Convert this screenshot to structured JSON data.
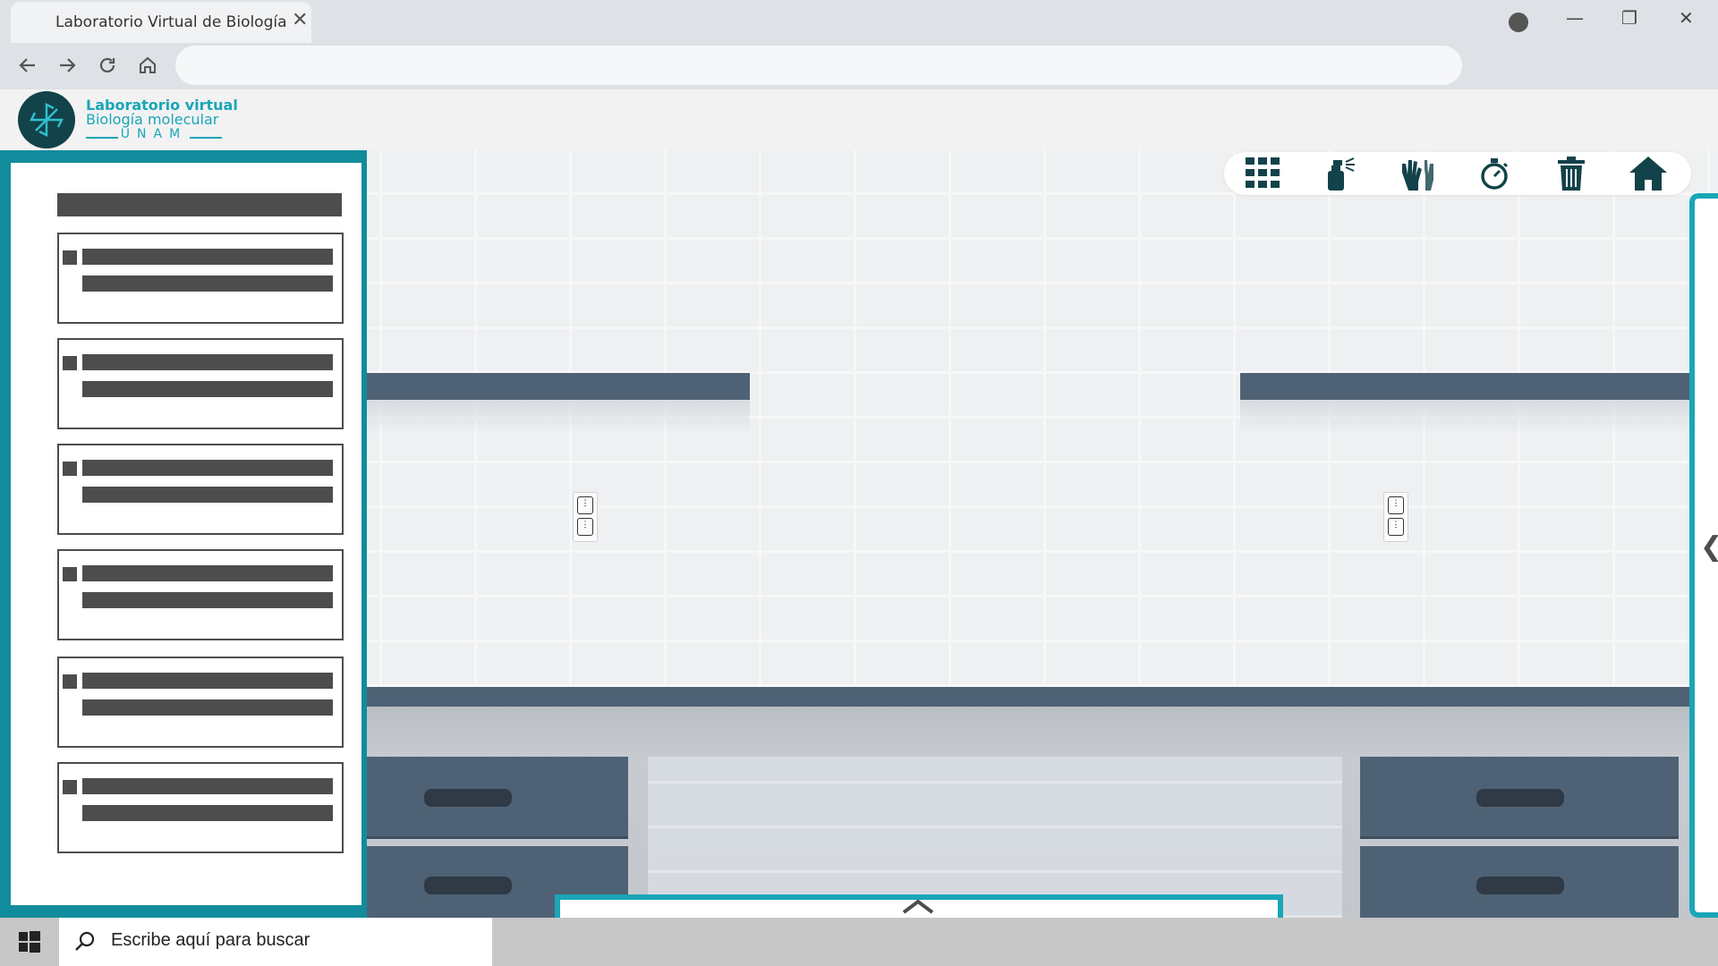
{
  "browser": {
    "tab_title": "Laboratorio Virtual de Biología",
    "tab_close": "✕",
    "window_controls": {
      "minimize": "—",
      "restore": "❐",
      "close": "✕"
    },
    "address": ""
  },
  "logo": {
    "line1": "Laboratorio virtual",
    "line2": "Biología molecular",
    "line3": "UNAM"
  },
  "toolbar": {
    "icons": [
      "grid-menu-icon",
      "spray-bottle-icon",
      "gloves-icon",
      "stopwatch-icon",
      "trash-icon",
      "home-icon"
    ]
  },
  "procedure_panel": {
    "steps_count_visible": 6
  },
  "taskbar": {
    "search_placeholder": "Escribe aquí para buscar"
  },
  "colors": {
    "accent": "#1aa6b7",
    "panel_frame": "#118c9c",
    "shelf": "#4f6275",
    "placeholder": "#4d4d4d",
    "logo_dark": "#12424a"
  }
}
